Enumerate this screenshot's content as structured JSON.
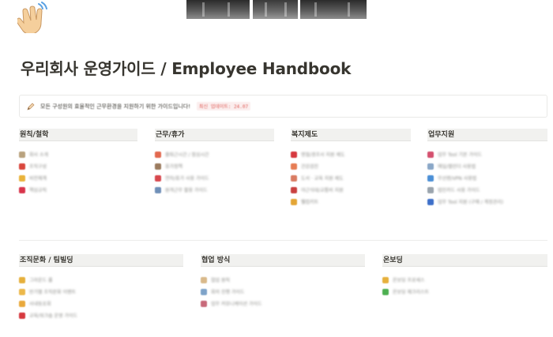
{
  "page": {
    "title": "우리회사 운영가이드 / Employee Handbook",
    "icon": "waving-hand-icon"
  },
  "callout": {
    "icon": "pen-icon",
    "text": "모든 구성원의 효율적인 근무환경을 지원하기 위한 가이드입니다!",
    "tag": "최신 업데이트: 24.07"
  },
  "sections_row1": [
    {
      "heading": "원칙/철학",
      "items": [
        {
          "label": "회사 소개",
          "icon_color": "#b9a27e"
        },
        {
          "label": "조직구성",
          "icon_color": "#d9473d"
        },
        {
          "label": "비전체계",
          "icon_color": "#e9b33a"
        },
        {
          "label": "핵심규칙",
          "icon_color": "#d8344a"
        }
      ]
    },
    {
      "heading": "근무/휴가",
      "items": [
        {
          "label": "출퇴근시간 / 점심시간",
          "icon_color": "#e2694f"
        },
        {
          "label": "휴가정책",
          "icon_color": "#9b7b5e"
        },
        {
          "label": "연차/휴가 사용 가이드",
          "icon_color": "#d7474d"
        },
        {
          "label": "원격근무 활용 가이드",
          "icon_color": "#6f8fb8"
        }
      ]
    },
    {
      "heading": "복지제도",
      "items": [
        {
          "label": "명절/경조사 지원 제도",
          "icon_color": "#d6393f"
        },
        {
          "label": "건강검진",
          "icon_color": "#e67d55"
        },
        {
          "label": "도서 · 교육 지원 제도",
          "icon_color": "#d97b62"
        },
        {
          "label": "야근식대/교통비 지원",
          "icon_color": "#c9403f"
        },
        {
          "label": "웰컴키트",
          "icon_color": "#e3a535"
        }
      ]
    },
    {
      "heading": "업무지원",
      "items": [
        {
          "label": "업무 Tool 기본 가이드",
          "icon_color": "#d4506e"
        },
        {
          "label": "메일/캘린더 사용법",
          "icon_color": "#8aa7c7"
        },
        {
          "label": "무선랜/VPN 사용법",
          "icon_color": "#4b8fd6"
        },
        {
          "label": "법인카드 사용 가이드",
          "icon_color": "#9aa4ad"
        },
        {
          "label": "업무 Tool 지원 (구매 / 계정관리)",
          "icon_color": "#3d6fc9"
        }
      ]
    }
  ],
  "sections_row2": [
    {
      "heading": "조직문화 / 팀빌딩",
      "items": [
        {
          "label": "그라운드 룰",
          "icon_color": "#e6b03c"
        },
        {
          "label": "반기별 조직문화 이벤트",
          "icon_color": "#ecb84a"
        },
        {
          "label": "사내동호회",
          "icon_color": "#e9a93c"
        },
        {
          "label": "교육/워크숍 운영 가이드",
          "icon_color": "#d6393f"
        }
      ]
    },
    {
      "heading": "협업 방식",
      "items": [
        {
          "label": "협업 원칙",
          "icon_color": "#d9b98a"
        },
        {
          "label": "회의 진행 가이드",
          "icon_color": "#7ea3c9"
        },
        {
          "label": "업무 커뮤니케이션 가이드",
          "icon_color": "#c86a7a"
        }
      ]
    },
    {
      "heading": "온보딩",
      "items": [
        {
          "label": "온보딩 프로세스",
          "icon_color": "#e6b03c"
        },
        {
          "label": "온보딩 체크리스트",
          "icon_color": "#4caf50"
        }
      ]
    }
  ]
}
